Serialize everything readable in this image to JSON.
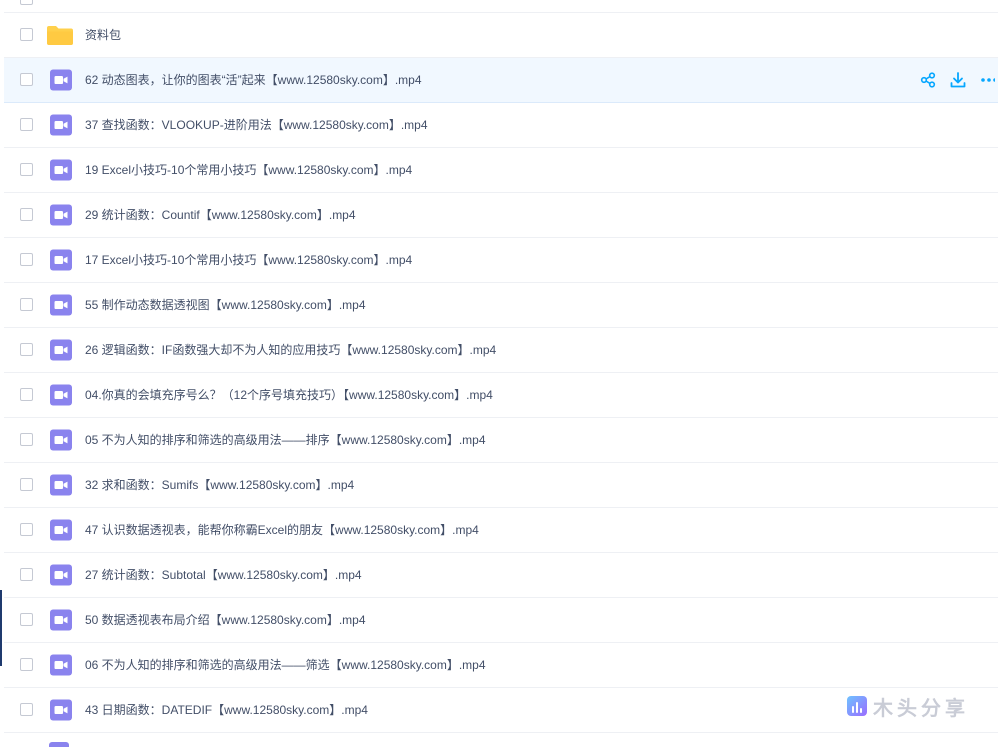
{
  "files": [
    {
      "name": "",
      "type": "folder",
      "partial": true
    },
    {
      "name": "资料包",
      "type": "folder"
    },
    {
      "name": "62 动态图表，让你的图表“活”起来【www.12580sky.com】.mp4",
      "type": "video",
      "highlighted": true
    },
    {
      "name": "37 查找函数：VLOOKUP-进阶用法【www.12580sky.com】.mp4",
      "type": "video"
    },
    {
      "name": "19 Excel小技巧-10个常用小技巧【www.12580sky.com】.mp4",
      "type": "video"
    },
    {
      "name": "29 统计函数：Countif【www.12580sky.com】.mp4",
      "type": "video"
    },
    {
      "name": "17 Excel小技巧-10个常用小技巧【www.12580sky.com】.mp4",
      "type": "video"
    },
    {
      "name": "55 制作动态数据透视图【www.12580sky.com】.mp4",
      "type": "video"
    },
    {
      "name": "26 逻辑函数：IF函数强大却不为人知的应用技巧【www.12580sky.com】.mp4",
      "type": "video"
    },
    {
      "name": "04.你真的会填充序号么？（12个序号填充技巧）【www.12580sky.com】.mp4",
      "type": "video"
    },
    {
      "name": "05 不为人知的排序和筛选的高级用法——排序【www.12580sky.com】.mp4",
      "type": "video"
    },
    {
      "name": "32 求和函数：Sumifs【www.12580sky.com】.mp4",
      "type": "video"
    },
    {
      "name": "47 认识数据透视表，能帮你称霸Excel的朋友【www.12580sky.com】.mp4",
      "type": "video"
    },
    {
      "name": "27 统计函数：Subtotal【www.12580sky.com】.mp4",
      "type": "video"
    },
    {
      "name": "50 数据透视表布局介绍【www.12580sky.com】.mp4",
      "type": "video"
    },
    {
      "name": "06 不为人知的排序和筛选的高级用法——筛选【www.12580sky.com】.mp4",
      "type": "video"
    },
    {
      "name": "43 日期函数：DATEDIF【www.12580sky.com】.mp4",
      "type": "video"
    }
  ],
  "row_actions": [
    "share-icon",
    "download-icon",
    "more-icon"
  ],
  "watermark": {
    "text": "木头分享"
  },
  "colors": {
    "video_icon": "#8a83ee",
    "folder_icon": "#ffd04b",
    "action_icon": "#06a7ff",
    "highlight_row": "#f1f8ff",
    "text": "#424e67"
  }
}
